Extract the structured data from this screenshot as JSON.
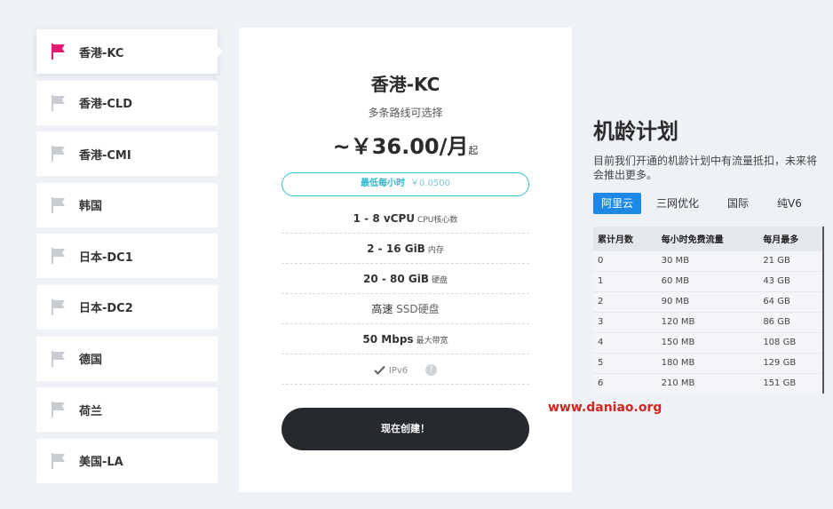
{
  "sidebar": {
    "items": [
      {
        "label": "香港-KC",
        "active": true
      },
      {
        "label": "香港-CLD",
        "active": false
      },
      {
        "label": "香港-CMI",
        "active": false
      },
      {
        "label": "韩国",
        "active": false
      },
      {
        "label": "日本-DC1",
        "active": false
      },
      {
        "label": "日本-DC2",
        "active": false
      },
      {
        "label": "德国",
        "active": false
      },
      {
        "label": "荷兰",
        "active": false
      },
      {
        "label": "美国-LA",
        "active": false
      }
    ],
    "active_flag_color": "#e6186f",
    "inactive_flag_color": "#c9cdd2"
  },
  "plan": {
    "title": "香港-KC",
    "subtitle": "多条路线可选择",
    "price": "~￥36.00/月",
    "price_unit": "起",
    "hourly_label": "最低每小时",
    "hourly_value": "￥0.0500",
    "specs": [
      {
        "value": "1 - 8 vCPU",
        "unit": "CPU核心数"
      },
      {
        "value": "2 - 16 GiB",
        "unit": "内存"
      },
      {
        "value": "20 - 80 GiB",
        "unit": "硬盘"
      },
      {
        "value": "高速",
        "unit": "SSD硬盘"
      },
      {
        "value": "50 Mbps",
        "unit": "最大带宽"
      }
    ],
    "ipv6_label": "IPv6",
    "help_icon": "?",
    "create_label": "现在创建！"
  },
  "plan_info": {
    "title": "机龄计划",
    "description": "目前我们开通的机龄计划中有流量抵扣，未来将会推出更多。",
    "tabs": [
      {
        "label": "阿里云",
        "active": true
      },
      {
        "label": "三网优化",
        "active": false
      },
      {
        "label": "国际",
        "active": false
      },
      {
        "label": "纯V6",
        "active": false
      }
    ],
    "table": {
      "headers": [
        "累计月数",
        "每小时免费流量",
        "每月最多"
      ],
      "rows": [
        [
          "0",
          "30 MB",
          "21 GB"
        ],
        [
          "1",
          "60 MB",
          "43 GB"
        ],
        [
          "2",
          "90 MB",
          "64 GB"
        ],
        [
          "3",
          "120 MB",
          "86 GB"
        ],
        [
          "4",
          "150 MB",
          "108 GB"
        ],
        [
          "5",
          "180 MB",
          "129 GB"
        ],
        [
          "6",
          "210 MB",
          "151 GB"
        ]
      ]
    }
  },
  "watermark": "www.daniao.org"
}
